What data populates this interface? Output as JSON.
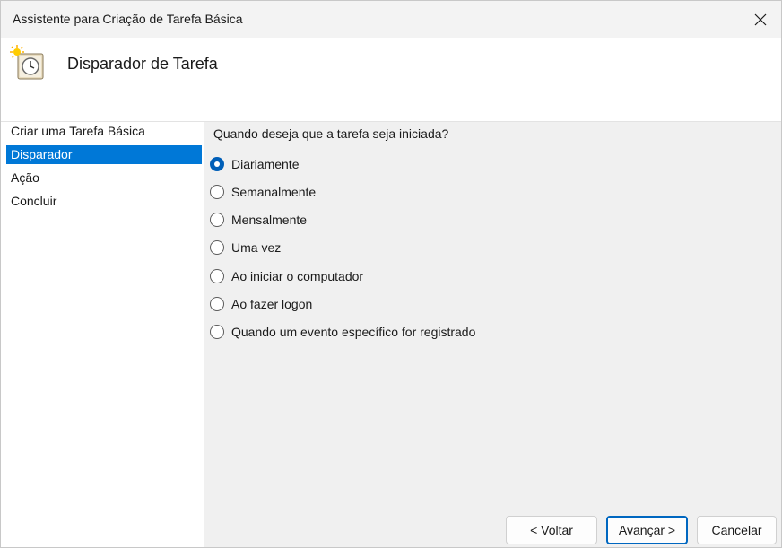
{
  "window": {
    "title": "Assistente para Criação de Tarefa Básica"
  },
  "header": {
    "title": "Disparador de Tarefa"
  },
  "sidebar": {
    "items": [
      {
        "label": "Criar uma Tarefa Básica",
        "selected": false
      },
      {
        "label": "Disparador",
        "selected": true
      },
      {
        "label": "Ação",
        "selected": false
      },
      {
        "label": "Concluir",
        "selected": false
      }
    ]
  },
  "main": {
    "question": "Quando deseja que a tarefa seja iniciada?",
    "options": [
      {
        "label": "Diariamente",
        "checked": true
      },
      {
        "label": "Semanalmente",
        "checked": false
      },
      {
        "label": "Mensalmente",
        "checked": false
      },
      {
        "label": "Uma vez",
        "checked": false
      },
      {
        "label": "Ao iniciar o computador",
        "checked": false
      },
      {
        "label": "Ao fazer logon",
        "checked": false
      },
      {
        "label": "Quando um evento específico for registrado",
        "checked": false
      }
    ]
  },
  "buttons": {
    "back": "< Voltar",
    "next": "Avançar >",
    "cancel": "Cancelar"
  },
  "colors": {
    "selection": "#0078d7",
    "accent": "#005fb8"
  }
}
